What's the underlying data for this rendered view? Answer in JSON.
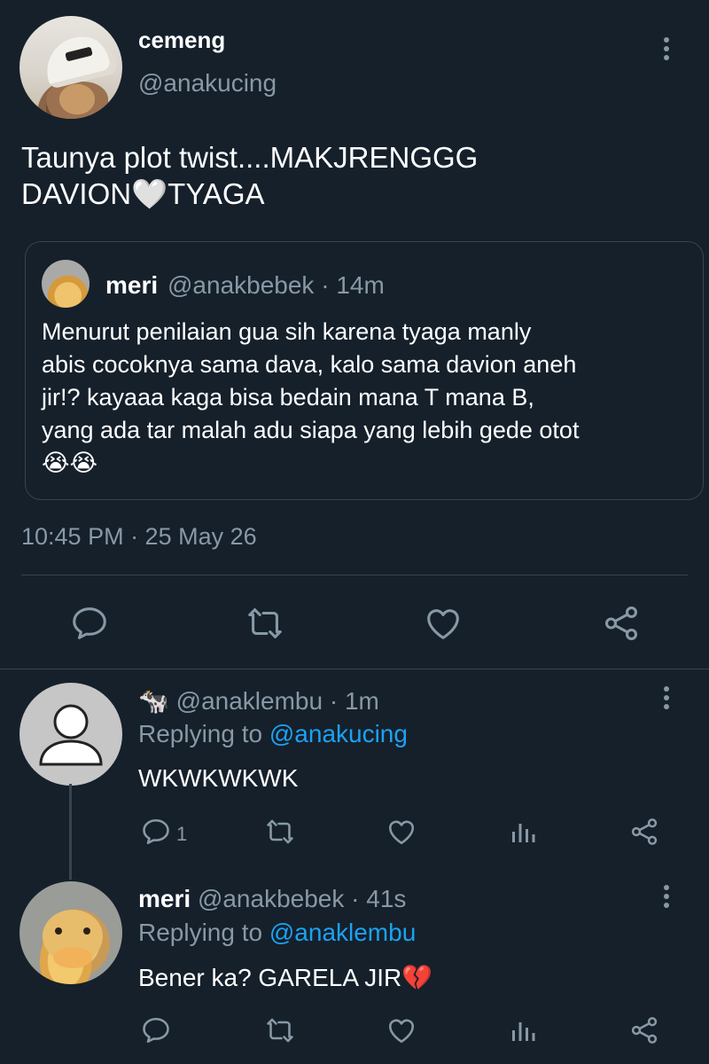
{
  "main_tweet": {
    "author_name": "cemeng",
    "author_handle": "@anakucing",
    "text": "Taunya plot twist....MAKJRENGGG\nDAVION🤍TYAGA",
    "timestamp": "10:45 PM · 25 May 26",
    "quoted": {
      "author_name": "meri",
      "meta": "@anakbebek · 14m",
      "text": "Menurut penilaian gua sih karena tyaga manly\nabis cocoknya sama dava, kalo sama davion aneh\njir!? kayaaa kaga bisa bedain mana T mana B,\nyang ada tar malah adu siapa yang lebih gede otot\n😭😭"
    }
  },
  "replies": [
    {
      "name_emoji": "🐄",
      "meta": "@anaklembu · 1m",
      "replying_prefix": "Replying to ",
      "replying_to": "@anakucing",
      "text": "WKWKWKWK",
      "reply_count": "1"
    },
    {
      "author_name": "meri",
      "meta": "@anakbebek · 41s",
      "replying_prefix": "Replying to ",
      "replying_to": "@anaklembu",
      "text": "Bener ka? GARELA JIR💔",
      "reply_count": ""
    }
  ],
  "icons": [
    "reply-icon",
    "retweet-icon",
    "like-icon",
    "share-icon",
    "analytics-icon",
    "more-icon"
  ],
  "colors": {
    "background": "#15202b",
    "text": "#ffffff",
    "muted": "#8899a6",
    "link": "#1da1f2",
    "border": "#38444d"
  }
}
